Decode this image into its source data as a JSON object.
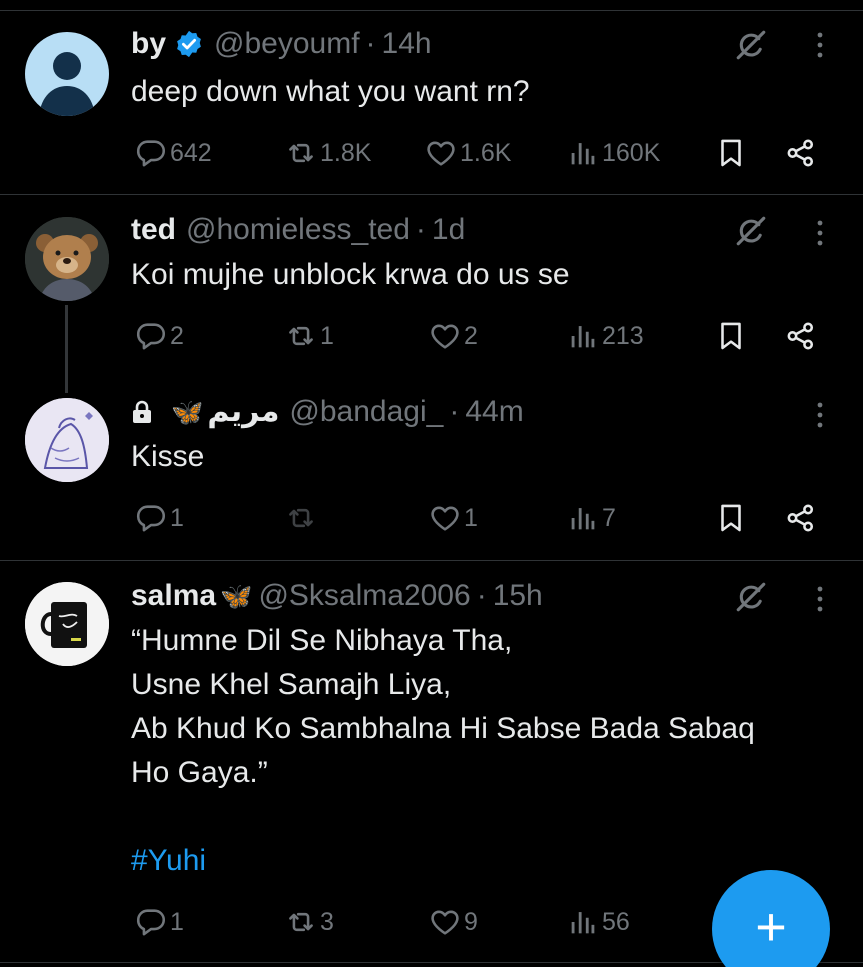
{
  "tweets": [
    {
      "name": "by",
      "verified": true,
      "handle": "@beyoumf",
      "separator": "·",
      "time": "14h",
      "text": [
        "deep down what you want rn?"
      ],
      "replies": "642",
      "reposts": "1.8K",
      "likes": "1.6K",
      "views": "160K"
    },
    {
      "name": "ted",
      "handle": "@homieless_ted",
      "separator": "·",
      "time": "1d",
      "text": [
        "Koi mujhe unblock krwa do us se"
      ],
      "replies": "2",
      "reposts": "1",
      "likes": "2",
      "views": "213"
    },
    {
      "name": "مريم",
      "name_emoji": "🦋",
      "protected": true,
      "handle": "@bandagi_",
      "separator": "·",
      "time": "44m",
      "text": [
        "Kisse"
      ],
      "replies": "1",
      "reposts": "",
      "likes": "1",
      "views": "7"
    },
    {
      "name": "salma",
      "name_emoji": "🦋",
      "handle": "@Sksalma2006",
      "separator": "·",
      "time": "15h",
      "text": [
        "“Humne Dil Se Nibhaya Tha,",
        "Usne Khel Samajh Liya,",
        "Ab Khud Ko Sambhalna Hi Sabse Bada Sabaq",
        "Ho Gaya.”"
      ],
      "hashtag": "#Yuhi",
      "replies": "1",
      "reposts": "3",
      "likes": "9",
      "views": "56"
    }
  ],
  "fab": {
    "label": "+"
  },
  "icons": {
    "reply": "reply-icon",
    "repost": "repost-icon",
    "like": "like-icon",
    "views": "views-icon",
    "bookmark": "bookmark-icon",
    "share": "share-icon",
    "grok": "grok-icon",
    "more": "more-icon",
    "verified": "verified-badge-icon",
    "lock": "lock-icon"
  },
  "colors": {
    "background": "#000000",
    "text": "#e7e9ea",
    "muted": "#71767b",
    "accent": "#1d9bf0",
    "divider": "#2f3336"
  }
}
